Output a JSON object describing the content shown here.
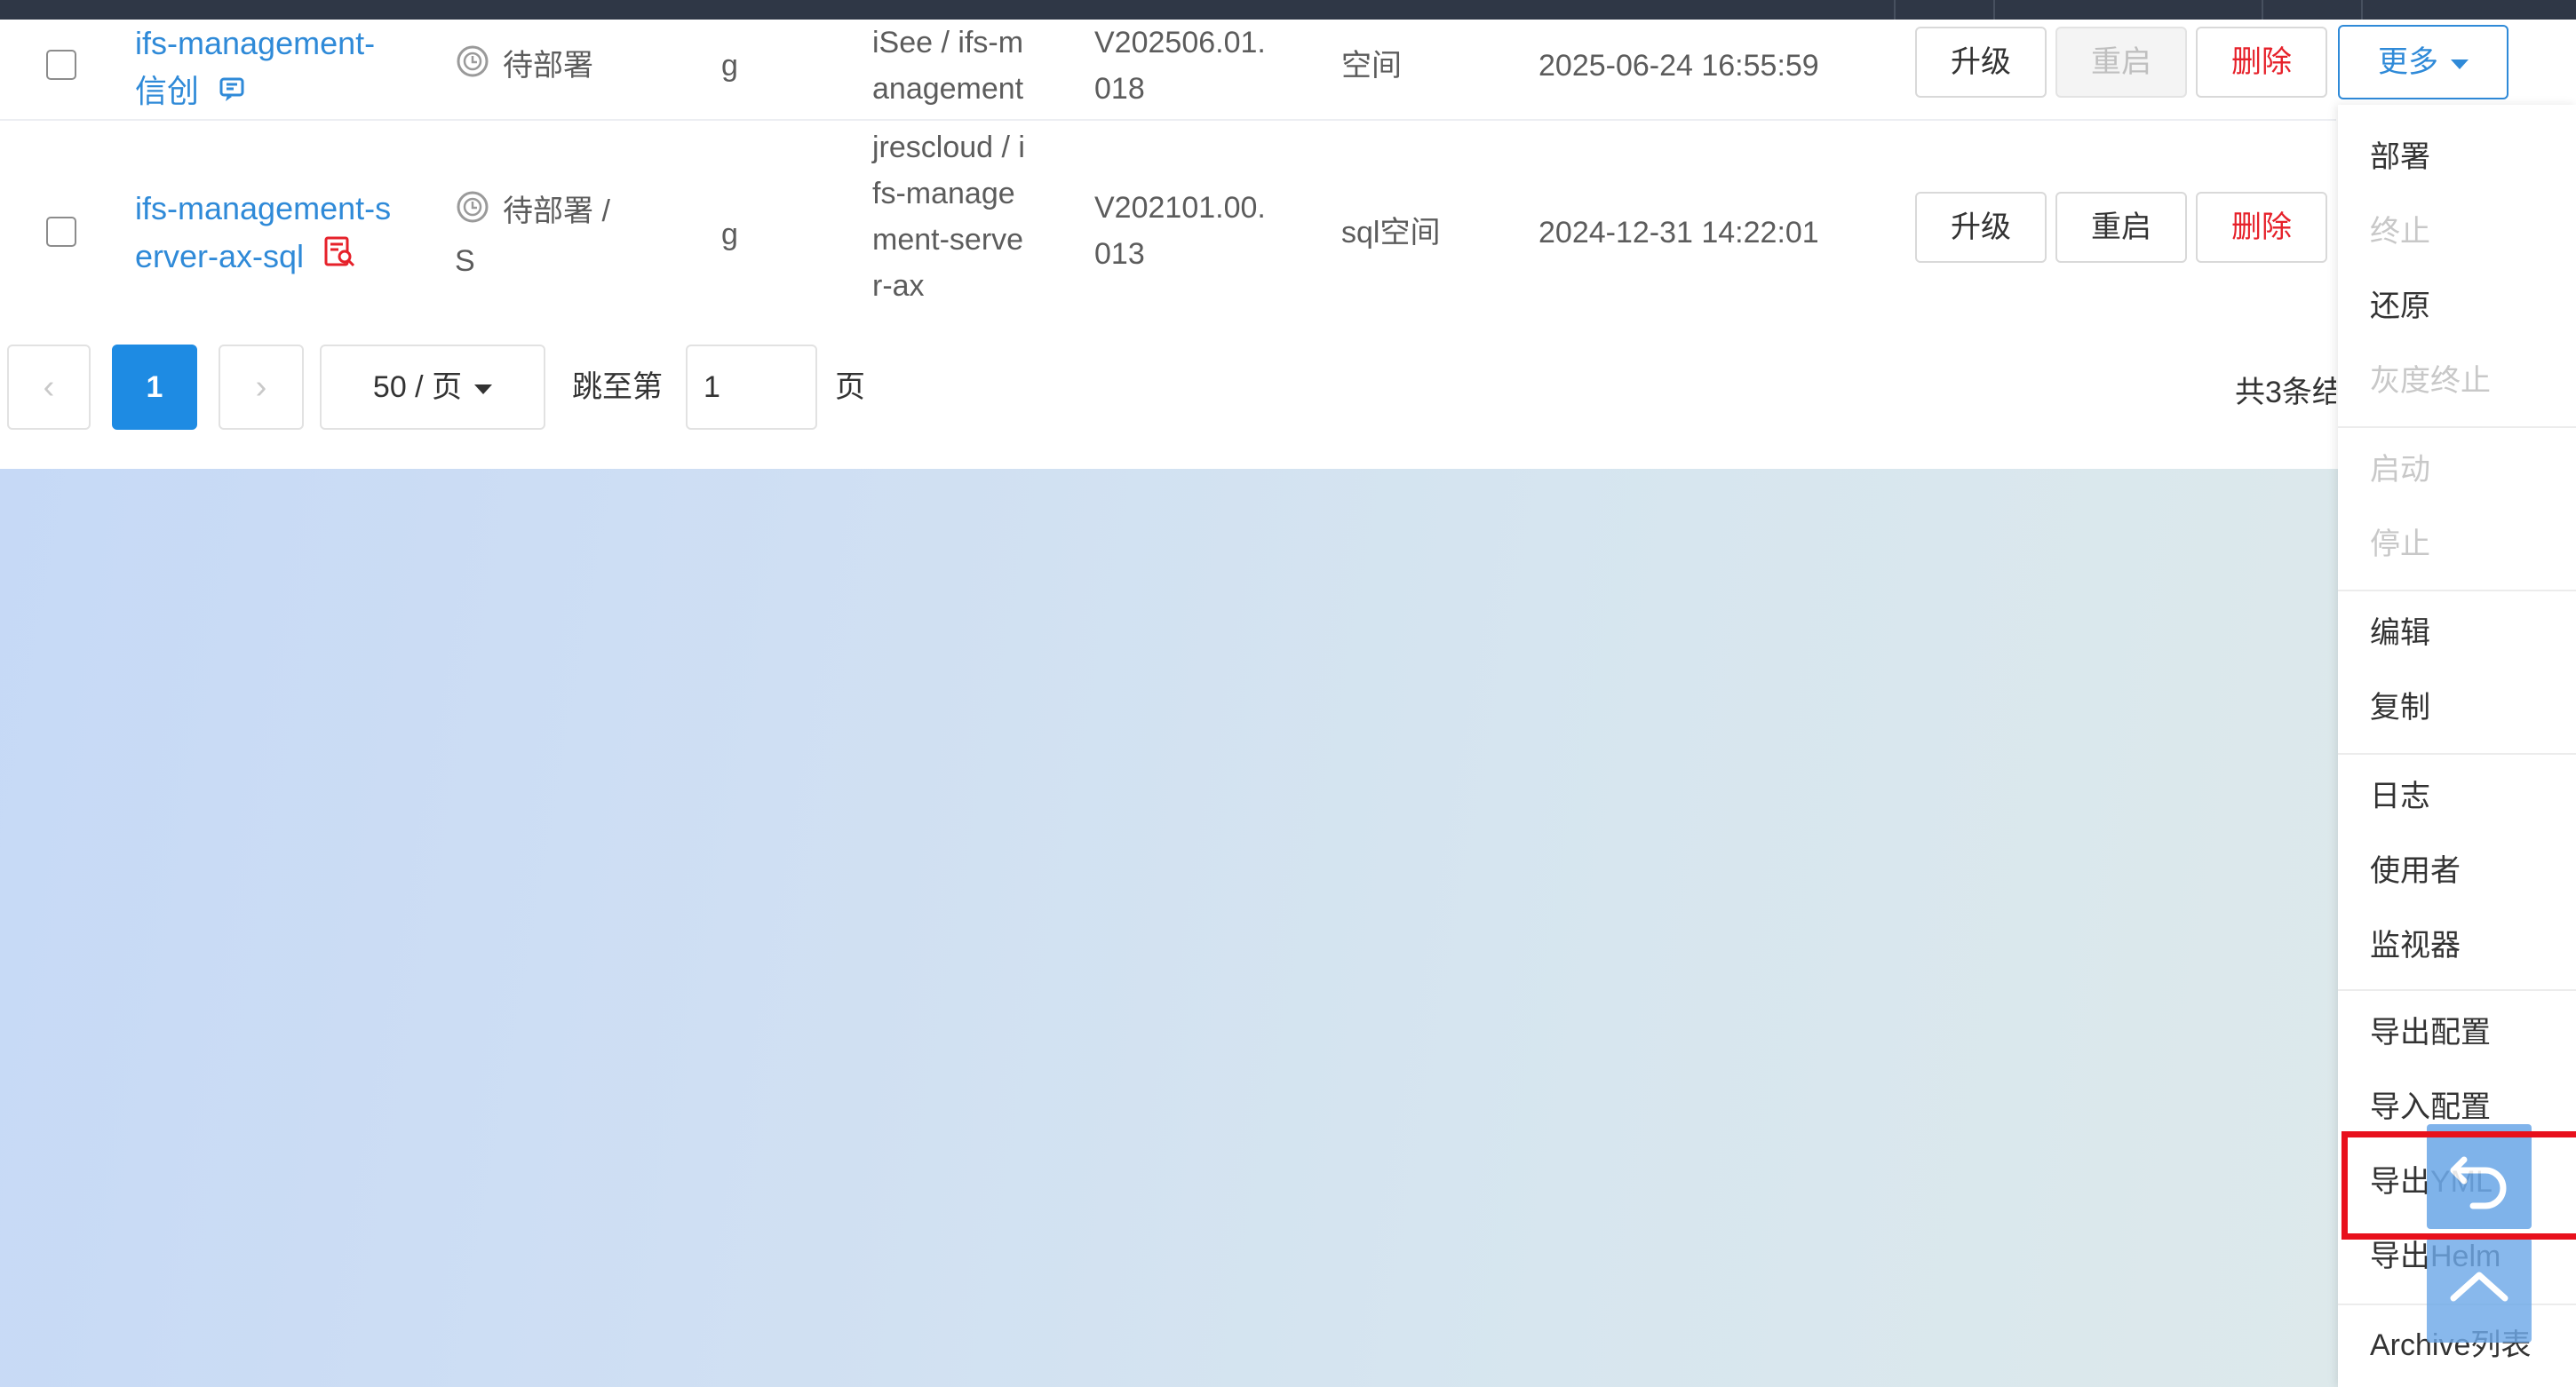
{
  "colors": {
    "link": "#2f8ad8",
    "danger": "#e6212a",
    "primary": "#1e8be3",
    "highlight": "#e8101c"
  },
  "rows": [
    {
      "name_line1": "ifs-management-",
      "name_line2": "信创",
      "name_icon": "doc-check-icon",
      "status_icon": "clock-icon",
      "status": "待部署",
      "col3": "g",
      "image_line1": "iSee / ifs-m",
      "image_line2": "anagement",
      "version_line1": "V202506.01.",
      "version_line2": "018",
      "namespace": "空间",
      "time": "2025-06-24 16:55:59",
      "btn_upgrade": "升级",
      "btn_restart": "重启",
      "btn_delete": "删除",
      "btn_more": "更多"
    },
    {
      "name_line1": "ifs-management-s",
      "name_line2": "erver-ax-sql",
      "name_icon": "doc-search-icon",
      "status_icon": "clock-icon",
      "status": "待部署 /",
      "status_line2": "S",
      "col3": "g",
      "image_line1": "jrescloud / i",
      "image_line2": "fs-manage",
      "image_line3": "ment-serve",
      "image_line4": "r-ax",
      "version_line1": "V202101.00.",
      "version_line2": "013",
      "namespace": "sql空间",
      "time": "2024-12-31 14:22:01",
      "btn_upgrade": "升级",
      "btn_restart": "重启",
      "btn_delete": "删除"
    }
  ],
  "pagination": {
    "prev": "‹",
    "current": "1",
    "next": "›",
    "page_size": "50 / 页",
    "jump_label": "跳至第",
    "jump_value": "1",
    "page_suffix": "页",
    "total": "共3条结"
  },
  "dropdown": {
    "items": [
      {
        "label": "部署",
        "disabled": false
      },
      {
        "label": "终止",
        "disabled": true
      },
      {
        "label": "还原",
        "disabled": false
      },
      {
        "label": "灰度终止",
        "disabled": true
      },
      {
        "label": "启动",
        "disabled": true
      },
      {
        "label": "停止",
        "disabled": true
      },
      {
        "label": "编辑",
        "disabled": false
      },
      {
        "label": "复制",
        "disabled": false
      },
      {
        "label": "日志",
        "disabled": false
      },
      {
        "label": "使用者",
        "disabled": false
      },
      {
        "label": "监视器",
        "disabled": false
      },
      {
        "label": "导出配置",
        "disabled": false
      },
      {
        "label": "导入配置",
        "disabled": false
      },
      {
        "label": "导出YML",
        "disabled": false
      },
      {
        "label": "导出Helm",
        "disabled": false
      },
      {
        "label": "Archive列表",
        "disabled": false
      }
    ]
  },
  "floating": {
    "undo_icon": "undo-icon",
    "top_icon": "chevron-up-icon"
  }
}
